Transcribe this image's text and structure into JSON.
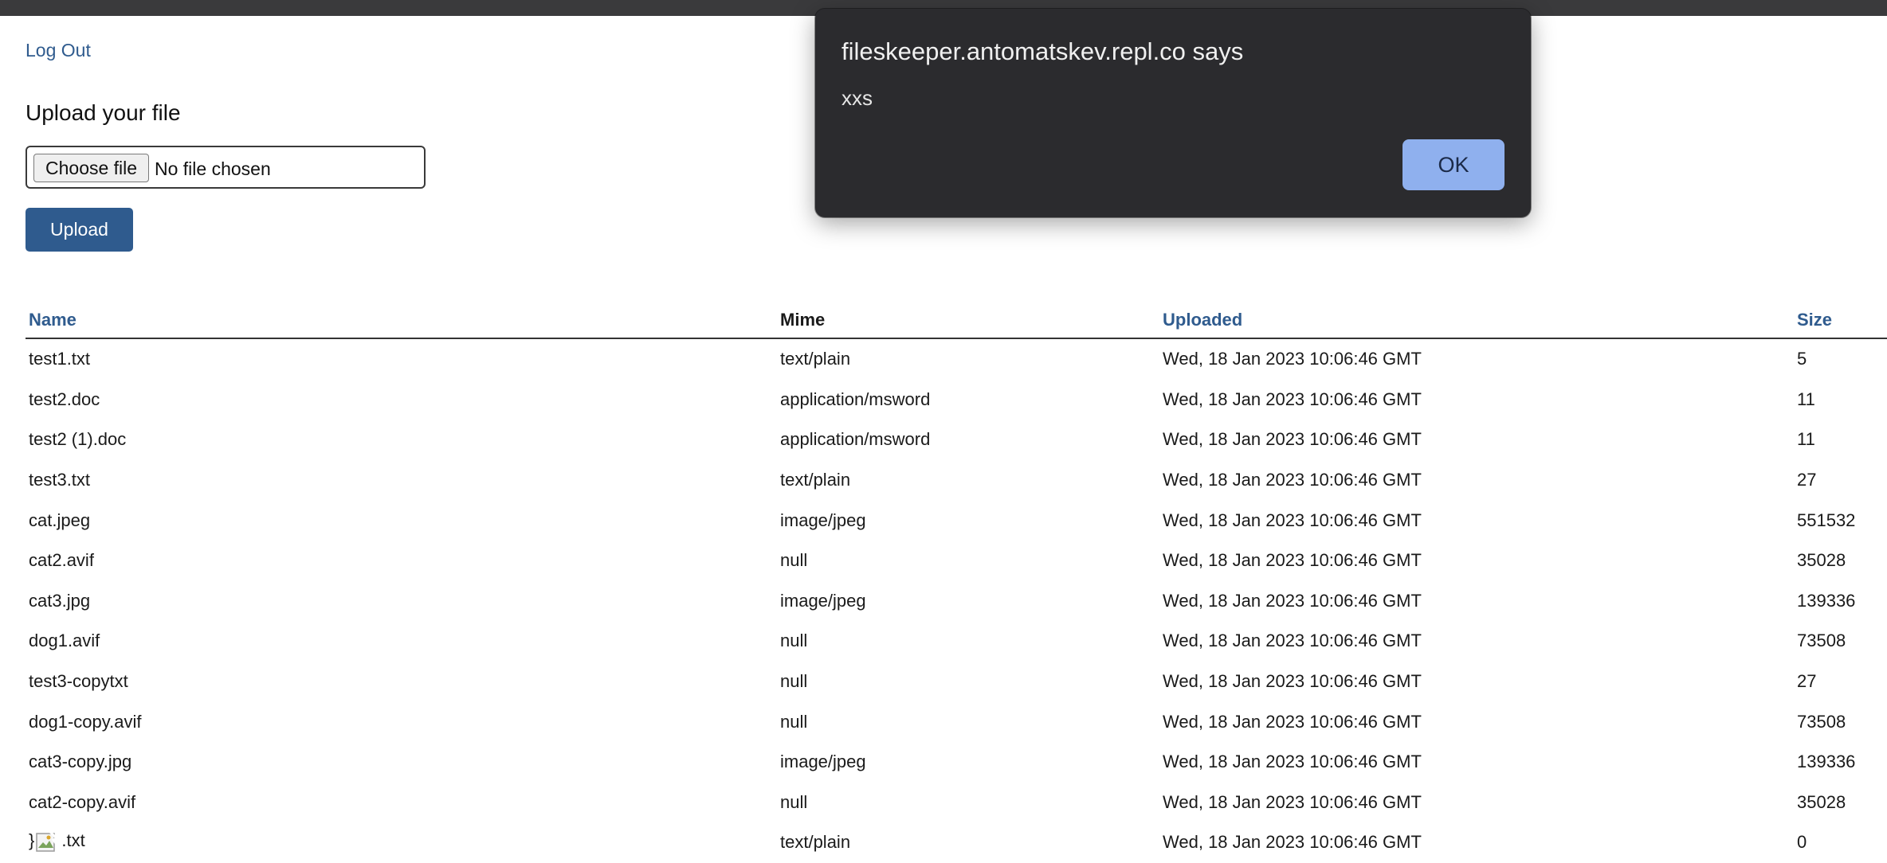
{
  "header": {
    "logout_label": "Log Out"
  },
  "upload": {
    "title": "Upload your file",
    "choose_label": "Choose file",
    "no_file_label": "No file chosen",
    "upload_label": "Upload"
  },
  "table": {
    "columns": [
      "Name",
      "Mime",
      "Uploaded",
      "Size"
    ],
    "rows": [
      {
        "name": "test1.txt",
        "mime": "text/plain",
        "uploaded": "Wed, 18 Jan 2023 10:06:46 GMT",
        "size": "5"
      },
      {
        "name": "test2.doc",
        "mime": "application/msword",
        "uploaded": "Wed, 18 Jan 2023 10:06:46 GMT",
        "size": "11"
      },
      {
        "name": "test2 (1).doc",
        "mime": "application/msword",
        "uploaded": "Wed, 18 Jan 2023 10:06:46 GMT",
        "size": "11"
      },
      {
        "name": "test3.txt",
        "mime": "text/plain",
        "uploaded": "Wed, 18 Jan 2023 10:06:46 GMT",
        "size": "27"
      },
      {
        "name": "cat.jpeg",
        "mime": "image/jpeg",
        "uploaded": "Wed, 18 Jan 2023 10:06:46 GMT",
        "size": "551532"
      },
      {
        "name": "cat2.avif",
        "mime": "null",
        "uploaded": "Wed, 18 Jan 2023 10:06:46 GMT",
        "size": "35028"
      },
      {
        "name": "cat3.jpg",
        "mime": "image/jpeg",
        "uploaded": "Wed, 18 Jan 2023 10:06:46 GMT",
        "size": "139336"
      },
      {
        "name": "dog1.avif",
        "mime": "null",
        "uploaded": "Wed, 18 Jan 2023 10:06:46 GMT",
        "size": "73508"
      },
      {
        "name": "test3-copytxt",
        "mime": "null",
        "uploaded": "Wed, 18 Jan 2023 10:06:46 GMT",
        "size": "27"
      },
      {
        "name": "dog1-copy.avif",
        "mime": "null",
        "uploaded": "Wed, 18 Jan 2023 10:06:46 GMT",
        "size": "73508"
      },
      {
        "name": "cat3-copy.jpg",
        "mime": "image/jpeg",
        "uploaded": "Wed, 18 Jan 2023 10:06:46 GMT",
        "size": "139336"
      },
      {
        "name": "cat2-copy.avif",
        "mime": "null",
        "uploaded": "Wed, 18 Jan 2023 10:06:46 GMT",
        "size": "35028"
      },
      {
        "name_prefix": "}",
        "name_suffix": ".txt",
        "mime": "text/plain",
        "uploaded": "Wed, 18 Jan 2023 10:06:46 GMT",
        "size": "0"
      }
    ]
  },
  "dialog": {
    "title": "fileskeeper.antomatskev.repl.co says",
    "message": "xxs",
    "ok_label": "OK"
  },
  "colors": {
    "link": "#2f5b8e",
    "upload_button": "#2f5b8e",
    "dialog_bg": "#2b2b2e",
    "ok_button": "#8fb0ee"
  }
}
